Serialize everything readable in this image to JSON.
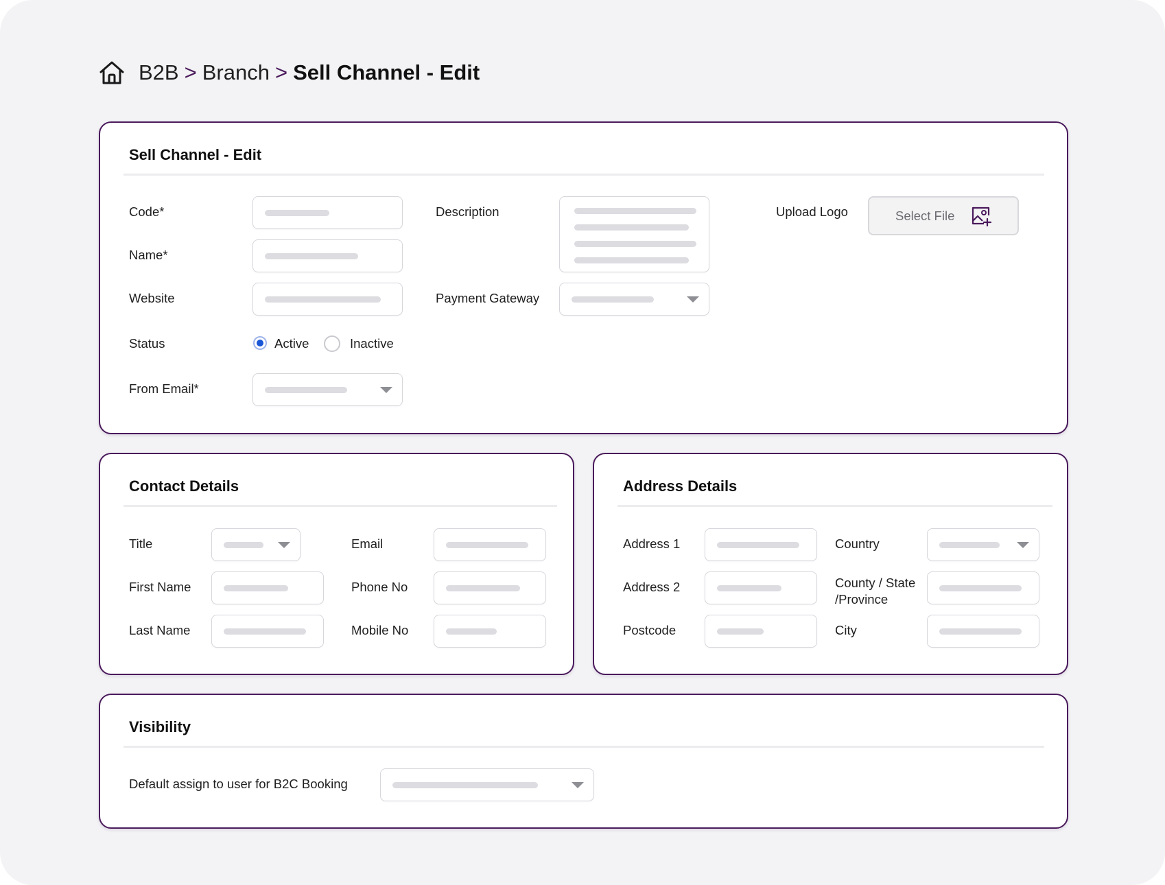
{
  "breadcrumb": {
    "items": [
      "B2B",
      "Branch"
    ],
    "separator": ">",
    "current": "Sell Channel - Edit"
  },
  "sell_channel": {
    "title": "Sell Channel - Edit",
    "code_label": "Code*",
    "name_label": "Name*",
    "website_label": "Website",
    "status_label": "Status",
    "status_options": [
      "Active",
      "Inactive"
    ],
    "status_selected": "Active",
    "from_email_label": "From Email*",
    "description_label": "Description",
    "payment_gateway_label": "Payment Gateway",
    "upload_logo_label": "Upload Logo",
    "select_file_label": "Select File"
  },
  "contact_details": {
    "title": "Contact Details",
    "title_label": "Title",
    "first_name_label": "First Name",
    "last_name_label": "Last Name",
    "email_label": "Email",
    "phone_label": "Phone No",
    "mobile_label": "Mobile No"
  },
  "address_details": {
    "title": "Address Details",
    "address1_label": "Address 1",
    "address2_label": "Address 2",
    "postcode_label": "Postcode",
    "country_label": "Country",
    "county_label_line1": "County / State",
    "county_label_line2": "/Province",
    "city_label": "City"
  },
  "visibility": {
    "title": "Visibility",
    "default_assign_label": "Default assign to user for B2C Booking"
  },
  "colors": {
    "accent": "#4a1a5c",
    "radio_selected": "#1a57d6",
    "background": "#f3f3f5",
    "placeholder_bar": "#dcdce1"
  },
  "icons": {
    "home": "home-icon",
    "dropdown": "chevron-down-icon",
    "upload": "image-add-icon"
  }
}
